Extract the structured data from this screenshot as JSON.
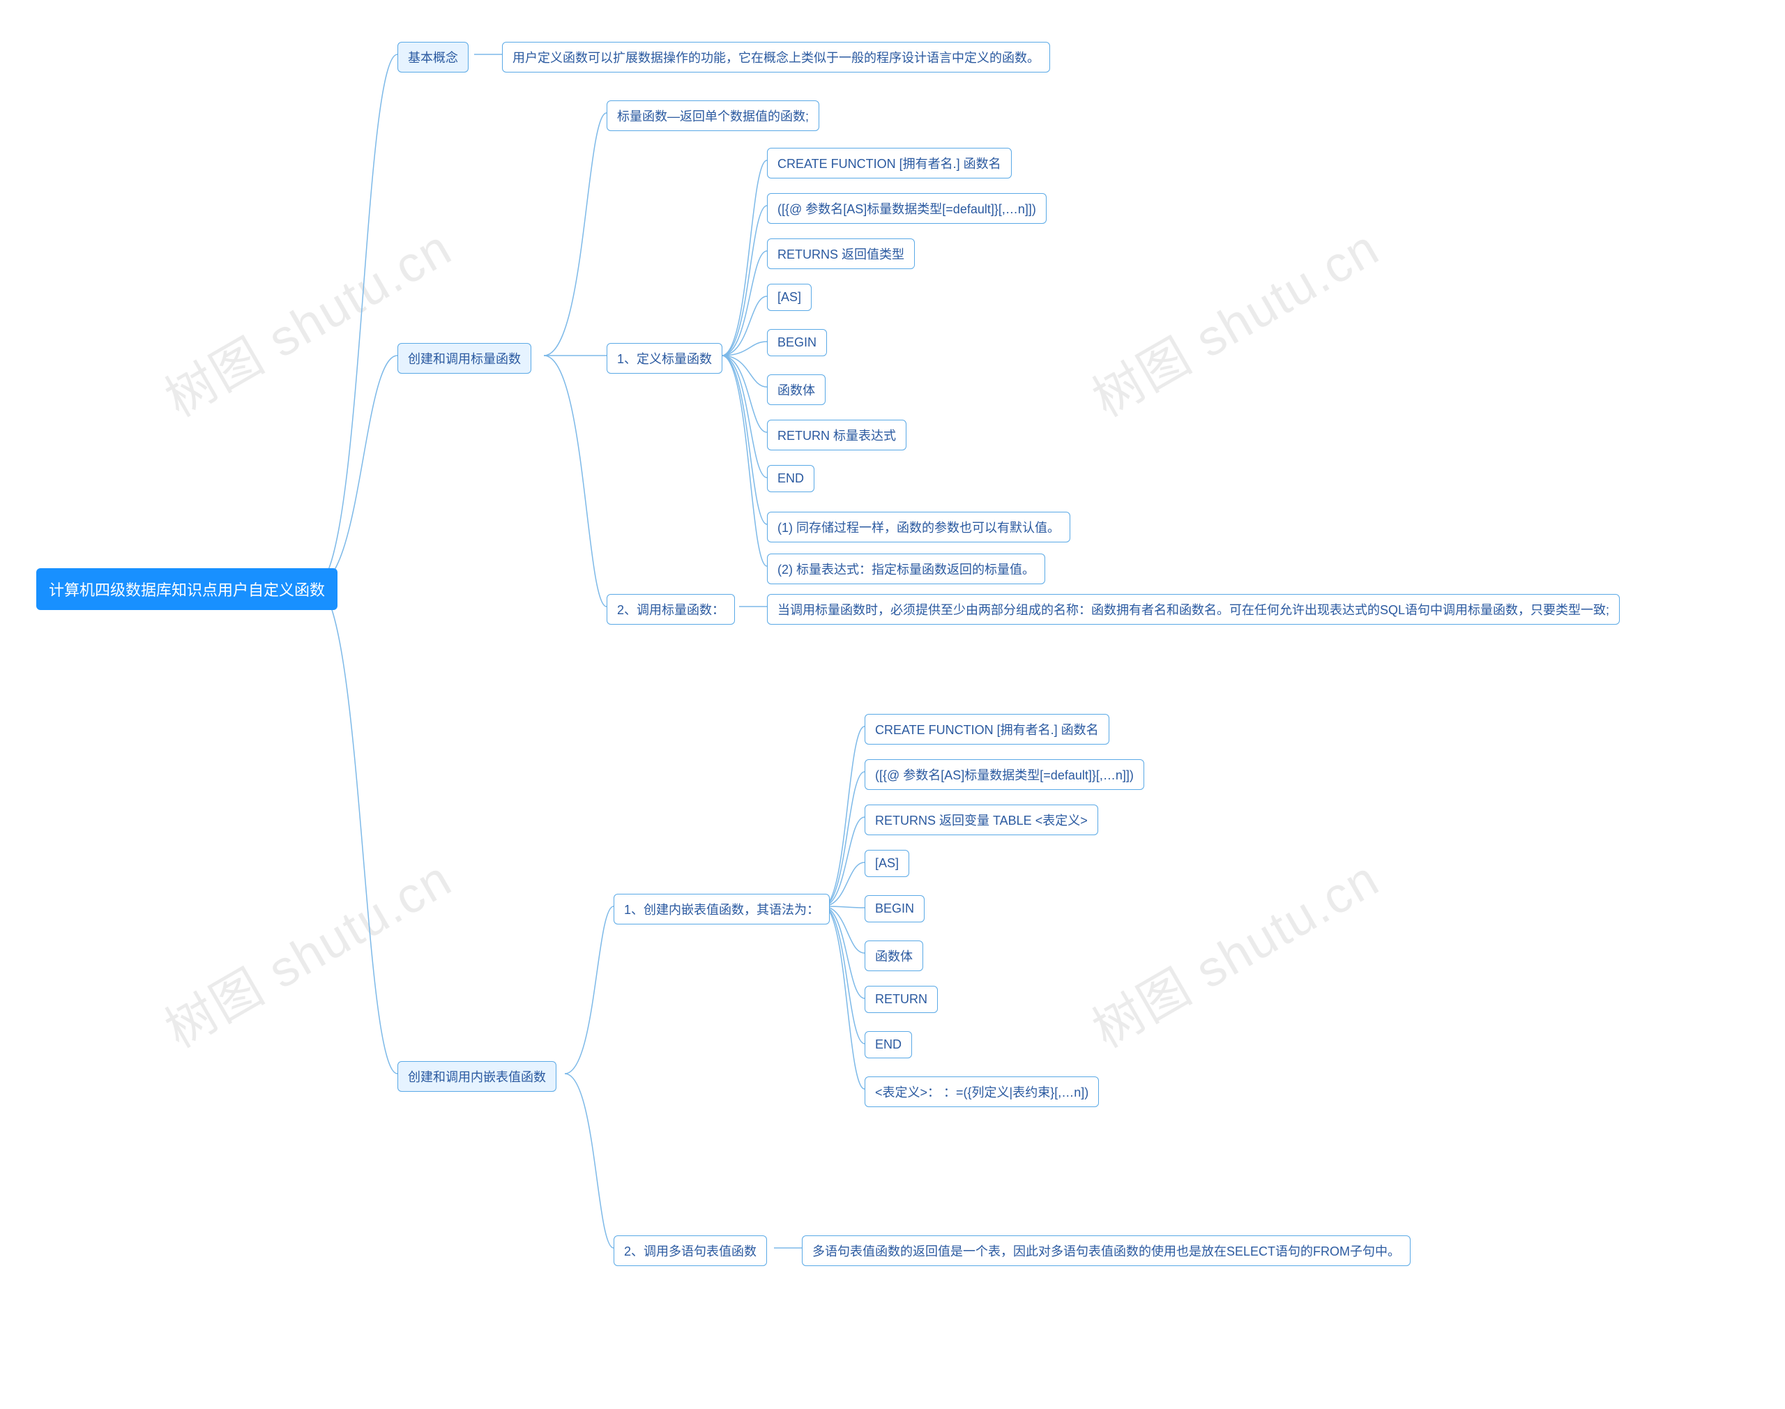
{
  "root": {
    "title": "计算机四级数据库知识点用户自定义函数"
  },
  "c1": {
    "title": "基本概念",
    "desc": "用户定义函数可以扩展数据操作的功能，它在概念上类似于一般的程序设计语言中定义的函数。"
  },
  "c2": {
    "title": "创建和调用标量函数",
    "n0": "标量函数—返回单个数据值的函数;",
    "n1": {
      "title": "1、定义标量函数",
      "items": [
        "CREATE FUNCTION [拥有者名.] 函数名",
        "([{@ 参数名[AS]标量数据类型[=default]}[,…n]])",
        "RETURNS 返回值类型",
        "[AS]",
        "BEGIN",
        "函数体",
        "RETURN 标量表达式",
        "END",
        "(1) 同存储过程一样，函数的参数也可以有默认值。",
        "(2) 标量表达式：指定标量函数返回的标量值。"
      ]
    },
    "n2": {
      "title": "2、调用标量函数：",
      "desc": "当调用标量函数时，必须提供至少由两部分组成的名称：函数拥有者名和函数名。可在任何允许出现表达式的SQL语句中调用标量函数，只要类型一致;"
    }
  },
  "c3": {
    "title": "创建和调用内嵌表值函数",
    "n1": {
      "title": "1、创建内嵌表值函数，其语法为：",
      "items": [
        "CREATE FUNCTION [拥有者名.] 函数名",
        "([{@ 参数名[AS]标量数据类型[=default]}[,…n]])",
        "RETURNS 返回变量 TABLE <表定义>",
        "[AS]",
        "BEGIN",
        "函数体",
        "RETURN",
        "END",
        "<表定义>： ：=({列定义|表约束}[,…n])"
      ]
    },
    "n2": {
      "title": "2、调用多语句表值函数",
      "desc": "多语句表值函数的返回值是一个表，因此对多语句表值函数的使用也是放在SELECT语句的FROM子句中。"
    }
  },
  "watermark": "树图 shutu.cn"
}
